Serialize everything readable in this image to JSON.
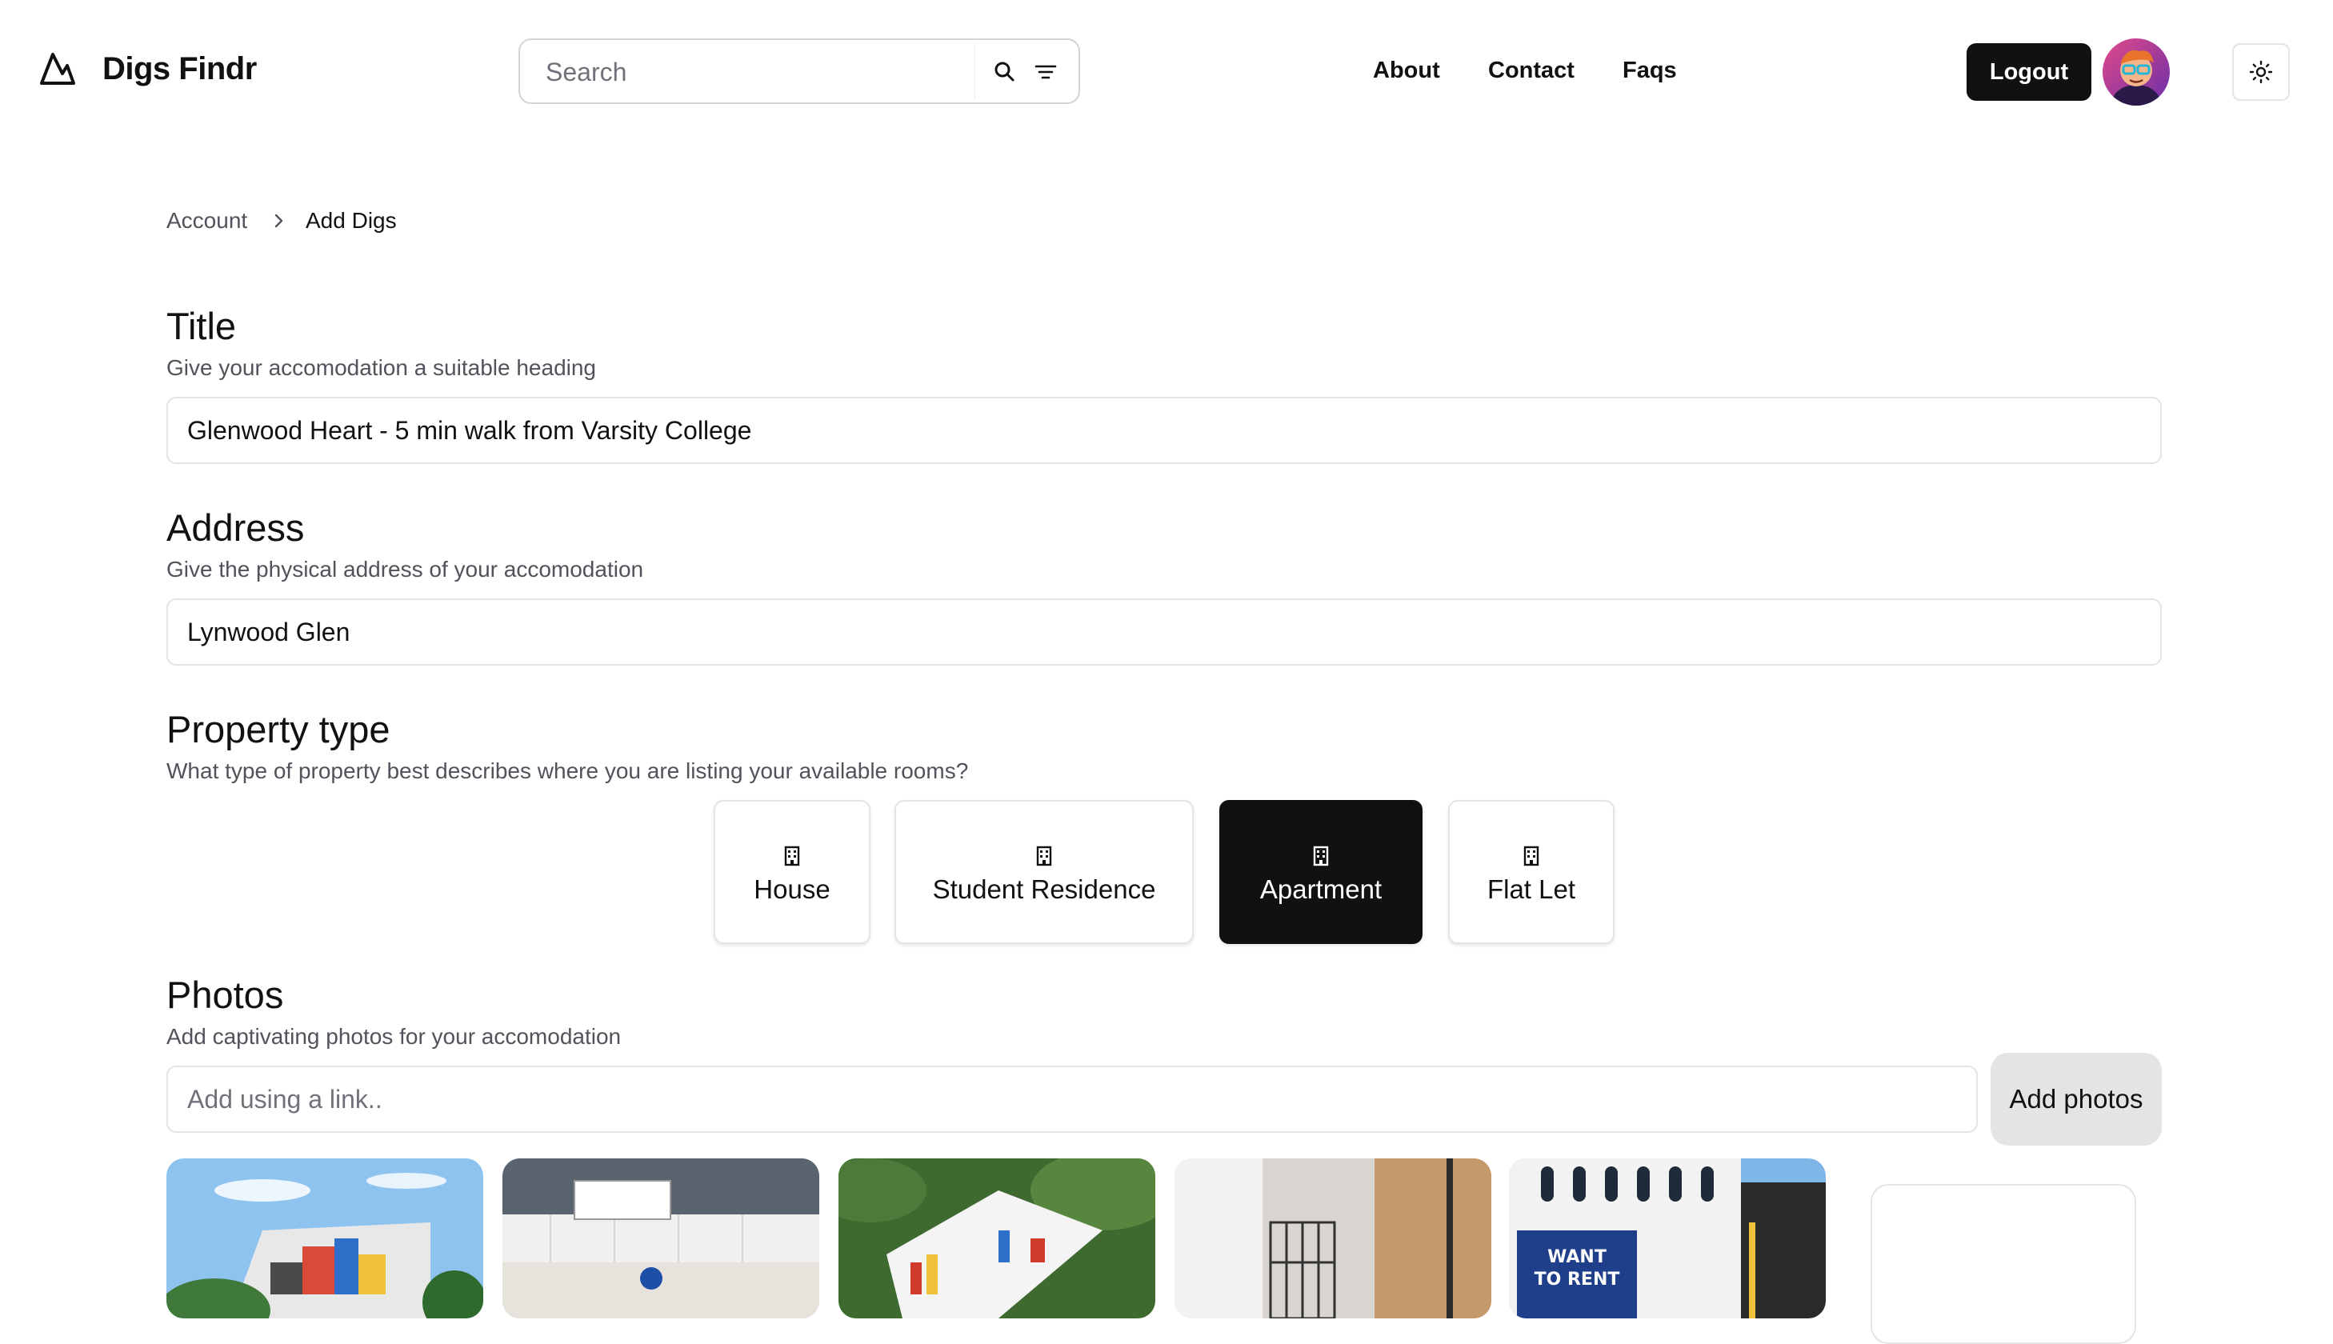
{
  "header": {
    "brand": "Digs Findr",
    "search_placeholder": "Search",
    "nav": [
      "About",
      "Contact",
      "Faqs"
    ],
    "logout_label": "Logout",
    "icons": [
      "mountain-logo-icon",
      "search-icon",
      "filter-icon",
      "sun-icon"
    ]
  },
  "breadcrumb": {
    "parent": "Account",
    "current": "Add Digs"
  },
  "title_section": {
    "heading": "Title",
    "description": "Give your accomodation a suitable heading",
    "value": "Glenwood Heart - 5 min walk from Varsity College"
  },
  "address_section": {
    "heading": "Address",
    "description": "Give the physical address of your accomodation",
    "value": "Lynwood Glen"
  },
  "property_section": {
    "heading": "Property type",
    "description": "What type of property best describes where you are listing your available rooms?",
    "types": [
      "House",
      "Student Residence",
      "Apartment",
      "Flat Let"
    ],
    "selected": "Apartment"
  },
  "photos_section": {
    "heading": "Photos",
    "description": "Add captivating photos for your accomodation",
    "link_placeholder": "Add using a link..",
    "add_button": "Add photos",
    "photo_sign_text": "WANT TO RENT"
  },
  "colors": {
    "primary": "#111111",
    "border": "#e4e4e7",
    "muted_text": "#52525b",
    "secondary_button": "#e4e4e7"
  }
}
